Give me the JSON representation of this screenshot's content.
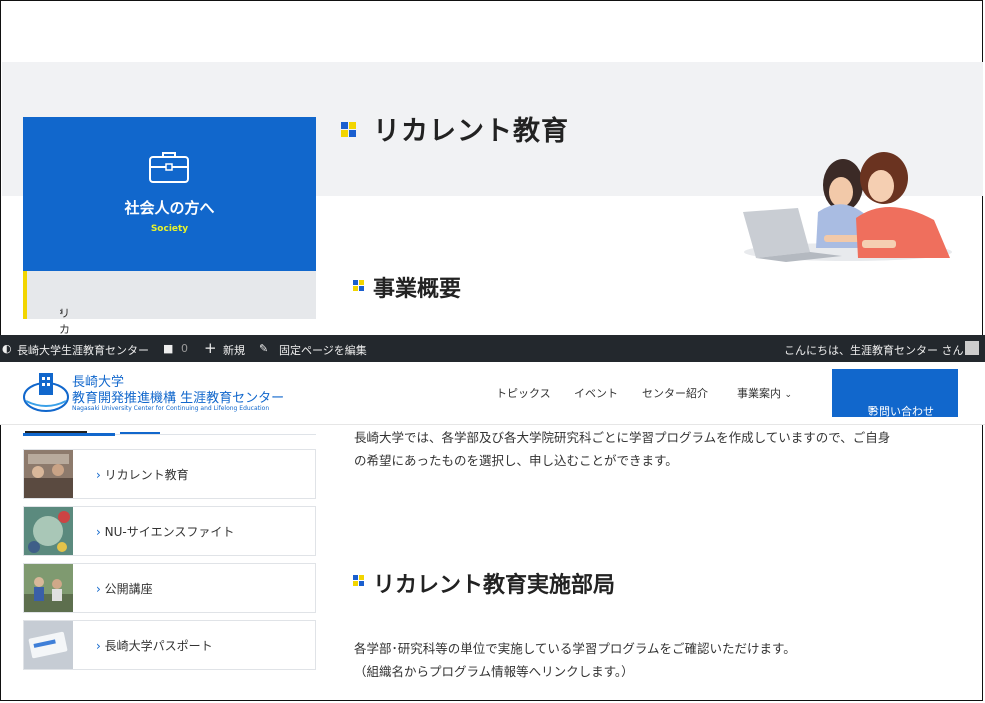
{
  "page": {
    "title": "リカレント教育"
  },
  "category": {
    "title": "社会人の方へ",
    "subtitle": "Society",
    "item_label": "リカレント教育"
  },
  "sections": {
    "overview": "事業概要",
    "departments": "リカレント教育実施部局"
  },
  "admin_bar": {
    "site_name": "長崎大学生涯教育センター",
    "comment_count": "0",
    "new_label": "新規",
    "edit_label": "固定ページを編集",
    "greeting": "こんにちは、生涯教育センター さん"
  },
  "header": {
    "logo_line1": "長崎大学",
    "logo_line2": "教育開発推進機構 生涯教育センター",
    "logo_line3": "Nagasaki University Center for Continuing and Lifelong Education",
    "nav": [
      "トピックス",
      "イベント",
      "センター紹介",
      "事業案内"
    ],
    "contact_label": "お問い合わせ"
  },
  "pickup": {
    "items": [
      "リカレント教育",
      "NU-サイエンスファイト",
      "公開講座",
      "長崎大学パスポート"
    ]
  },
  "content": {
    "overview_line1": "長崎大学では、各学部及び各大学院研究科ごとに学習プログラムを作成していますので、ご自身",
    "overview_line2": "の希望にあったものを選択し、申し込むことができます。",
    "dept_line1": "各学部･研究科等の単位で実施している学習プログラムをご確認いただけます。",
    "dept_line2": "（組織名からプログラム情報等へリンクします。）"
  },
  "colors": {
    "accent_blue": "#1167cc",
    "accent_yellow": "#f2d500",
    "admin_bar": "#23282d",
    "hero_bg": "#f1f2f4"
  }
}
